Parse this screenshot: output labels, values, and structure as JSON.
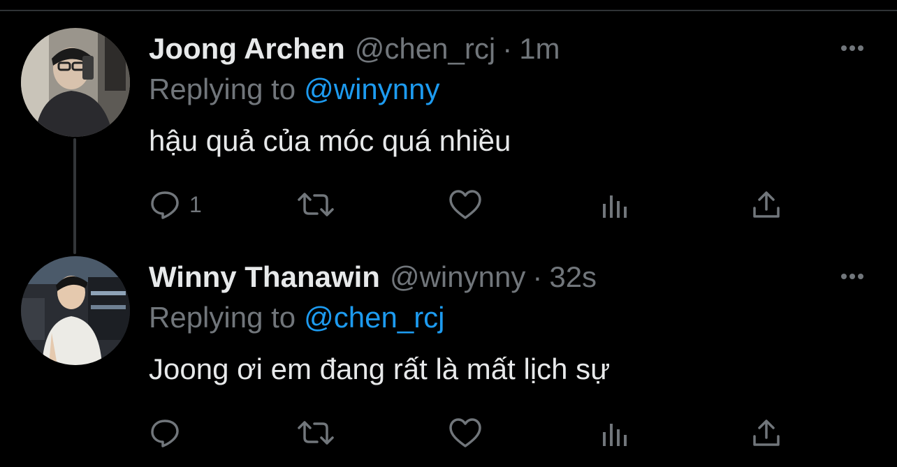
{
  "tweets": [
    {
      "display_name": "Joong Archen",
      "handle": "@chen_rcj",
      "separator": "·",
      "time": "1m",
      "replying_label": "Replying to",
      "replying_to": "@winynny",
      "text": "hậu quả của móc quá nhiều",
      "reply_count": "1",
      "more_icon": "ellipsis-icon"
    },
    {
      "display_name": "Winny Thanawin",
      "handle": "@winynny",
      "separator": "·",
      "time": "32s",
      "replying_label": "Replying to",
      "replying_to": "@chen_rcj",
      "text": "Joong ơi em đang rất là mất lịch sự",
      "reply_count": "",
      "more_icon": "ellipsis-icon"
    }
  ],
  "action_icons": [
    "reply-icon",
    "retweet-icon",
    "like-icon",
    "views-icon",
    "share-icon"
  ],
  "colors": {
    "background": "#000000",
    "primary_text": "#e7e9ea",
    "secondary_text": "#71767b",
    "accent": "#1d9bf0",
    "thread_line": "#333639"
  }
}
